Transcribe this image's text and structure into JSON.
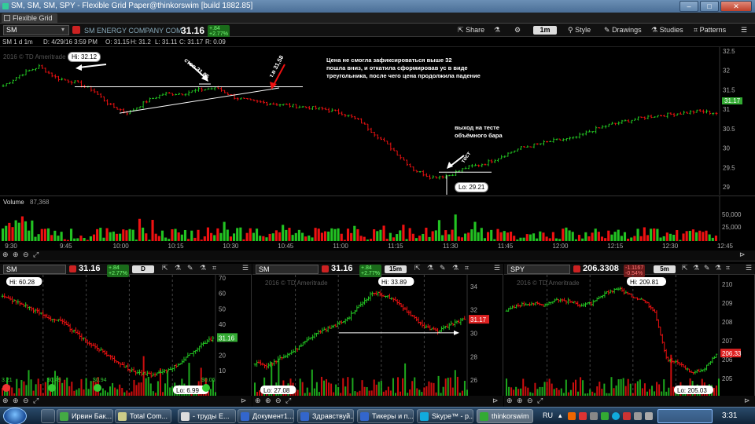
{
  "window": {
    "title": "SM, SM, SM, SPY - Flexible Grid Paper@thinkorswim [build 1882.85]",
    "tab": "Flexible Grid",
    "buttons": [
      "–",
      "□",
      "✕"
    ]
  },
  "toolbar": {
    "symbol": "SM",
    "company": "SM ENERGY COMPANY COM",
    "last": "31.16",
    "change": "+.84",
    "change_pct": "+2.77%",
    "share": "Share",
    "timeframe": "1m",
    "style": "Style",
    "drawings": "Drawings",
    "studies": "Studies",
    "patterns": "Patterns"
  },
  "infobar": {
    "period": "SM 1 d 1m",
    "date": "D: 4/29/16 3:59 PM",
    "open": "O: 31.15",
    "high": "H: 31.2",
    "low": "L: 31.11",
    "close": "C: 31.17",
    "range": "R: 0.09"
  },
  "main_chart": {
    "copyright": "2016 © TD Ameritrade",
    "hi_label": "Hi: 32.12",
    "lo_label": "Lo: 29.21",
    "price_tag": "31.17",
    "annot_stop": "стоп 31,65",
    "annot_entry": "т.в 31,58",
    "annot_text_1": "Цена не смогла зафиксироваться выше 32",
    "annot_text_2": "пошла вниз, и откатила сформировав ус в виде",
    "annot_text_3": "треугольника, после чего цена продолжила падение",
    "annot_exit_1": "выход на тесте",
    "annot_exit_2": "объёмного бара",
    "annot_test": "тест",
    "y_ticks": [
      "32.5",
      "32",
      "31.5",
      "31",
      "30.5",
      "30",
      "29.5",
      "29"
    ],
    "volume_label": "Volume",
    "volume_value": "87,368",
    "vol_ticks": [
      "50,000",
      "25,000"
    ],
    "x_ticks": [
      "9:30",
      "9:45",
      "10:00",
      "10:15",
      "10:30",
      "10:45",
      "11:00",
      "11:15",
      "11:30",
      "11:45",
      "12:00",
      "12:15",
      "12:30",
      "12:45"
    ]
  },
  "panels": [
    {
      "symbol": "SM",
      "price": "31.16",
      "change": "+.84",
      "change_pct": "+2.77%",
      "tf": "D",
      "hi": "Hi: 60.28",
      "lo": "Lo: 6.99",
      "price_tag": "31.16",
      "y_ticks": [
        "70",
        "60",
        "50",
        "40",
        "30",
        "20",
        "10"
      ],
      "marks": [
        "3.21",
        "$0.49",
        "$0.94",
        "$0.06"
      ]
    },
    {
      "symbol": "SM",
      "price": "31.16",
      "change": "+.84",
      "change_pct": "+2.77%",
      "tf": "15m",
      "hi": "Hi: 33.89",
      "lo": "Lo: 27.08",
      "price_tag": "31.17",
      "copyright": "2016 © TD Ameritrade",
      "y_ticks": [
        "34",
        "32",
        "30",
        "28",
        "26"
      ]
    },
    {
      "symbol": "SPY",
      "price": "206.3308",
      "change": "-1.1167",
      "change_pct": "-0.54%",
      "tf": "5m",
      "hi": "Hi: 209.81",
      "lo": "Lo: 205.03",
      "price_tag": "206.33",
      "copyright": "2016 © TD Ameritrade",
      "y_ticks": [
        "210",
        "209",
        "208",
        "207",
        "206",
        "205"
      ]
    }
  ],
  "taskbar": {
    "tasks": [
      "Ирвин Бак...",
      "Total Com...",
      "- труды Е...",
      "Документ1...",
      "Здравствуй...",
      "Тикеры и п...",
      "Skype™ - р...",
      "thinkorswim"
    ],
    "lang": "RU",
    "clock": "3:31"
  },
  "colors": {
    "up": "#22c322",
    "down": "#e11",
    "accent": "#3c6",
    "background": "#000000"
  }
}
